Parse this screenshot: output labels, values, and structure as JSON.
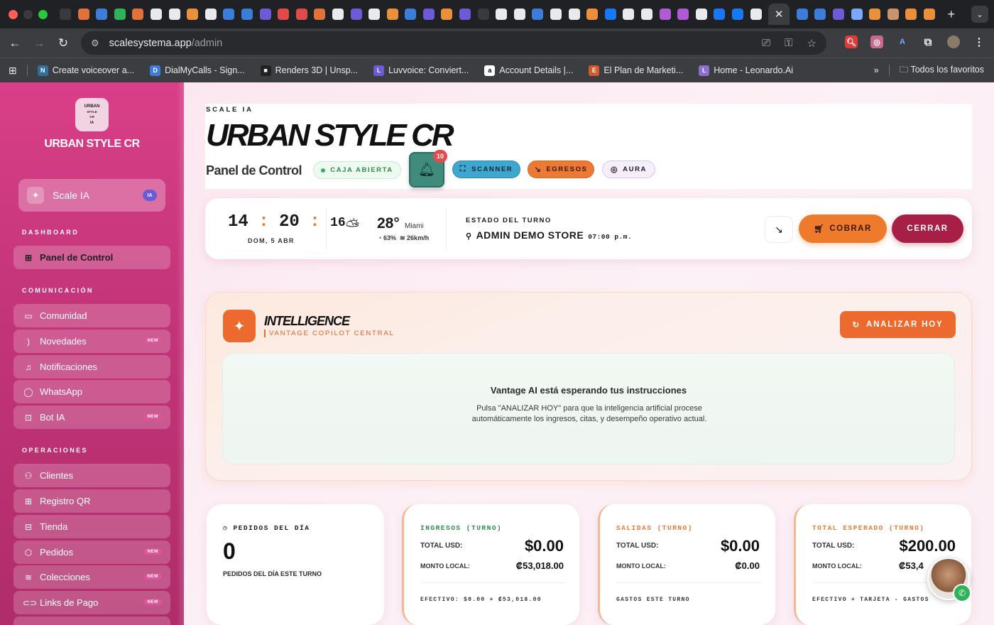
{
  "browser": {
    "url_host": "scalesystema.app",
    "url_path": "/admin",
    "bookmarks": [
      {
        "label": "Create voiceover a...",
        "color": "#2f6f9f",
        "icon_text": "N"
      },
      {
        "label": "DialMyCalls - Sign...",
        "color": "#3b7dd8",
        "icon_text": "D"
      },
      {
        "label": "Renders 3D | Unsp...",
        "color": "#222222",
        "icon_text": "■"
      },
      {
        "label": "Luvvoice: Conviert...",
        "color": "#6b5bd6",
        "icon_text": "L"
      },
      {
        "label": "Account Details |...",
        "color": "#ffffff",
        "icon_text": "a"
      },
      {
        "label": "El Plan de Marketi...",
        "color": "#d35b2b",
        "icon_text": "E"
      },
      {
        "label": "Home - Leonardo.Ai",
        "color": "#8a6fd1",
        "icon_text": "L"
      }
    ],
    "all_bookmarks_label": "Todos los favoritos"
  },
  "sidebar": {
    "logo_text": [
      "URBAN",
      "STYLE",
      "CR",
      "IA"
    ],
    "brand": "URBAN STYLE CR",
    "scale_label": "Scale IA",
    "scale_badge": "IA",
    "sections": {
      "dashboard": "DASHBOARD",
      "comunicacion": "COMUNICACIÓN",
      "operaciones": "OPERACIONES"
    },
    "items": {
      "panel": "Panel de Control",
      "comunidad": "Comunidad",
      "novedades": "Novedades",
      "notificaciones": "Notificaciones",
      "whatsapp": "WhatsApp",
      "botia": "Bot IA",
      "clientes": "Clientes",
      "registroqr": "Registro QR",
      "tienda": "Tienda",
      "pedidos": "Pedidos",
      "colecciones": "Colecciones",
      "links": "Links de Pago"
    },
    "new_badge": "NEW"
  },
  "header": {
    "eyebrow": "SCALE IA",
    "title": "URBAN STYLE CR",
    "subtitle": "Panel de Control",
    "caja_status": "CAJA ABIERTA",
    "notifications_count": "10",
    "scanner": "SCANNER",
    "egresos": "EGRESOS",
    "aura": "AURA"
  },
  "status": {
    "hours": "14",
    "minutes": "20",
    "seconds": "16",
    "date": "DOM, 5 ABR",
    "temperature": "28°",
    "city": "Miami",
    "humidity": "63%",
    "wind": "26km/h",
    "turno_label": "ESTADO DEL TURNO",
    "store": "ADMIN DEMO STORE",
    "turno_time": "07:00 p.m.",
    "cobrar": "COBRAR",
    "cerrar": "CERRAR"
  },
  "intelligence": {
    "title": "INTELLIGENCE",
    "subtitle": "VANTAGE COPILOT CENTRAL",
    "analyze_button": "ANALIZAR HOY",
    "empty_title": "Vantage AI está esperando tus instrucciones",
    "empty_text": "Pulsa \"ANALIZAR HOY\" para que la inteligencia artificial procese automáticamente los ingresos, citas, y desempeño operativo actual."
  },
  "stats": {
    "pedidos": {
      "title": "PEDIDOS DEL DÍA",
      "value": "0",
      "note": "PEDIDOS DEL DÍA ESTE TURNO"
    },
    "ingresos": {
      "title": "INGRESOS (TURNO)",
      "usd_label": "TOTAL USD:",
      "usd": "$0.00",
      "local_label": "MONTO LOCAL:",
      "local": "₡53,018.00",
      "foot": "EFECTIVO: $0.00 + ₡53,018.00"
    },
    "salidas": {
      "title": "SALIDAS (TURNO)",
      "usd_label": "TOTAL USD:",
      "usd": "$0.00",
      "local_label": "MONTO LOCAL:",
      "local": "₡0.00",
      "foot": "GASTOS ESTE TURNO"
    },
    "esperado": {
      "title": "TOTAL ESPERADO (TURNO)",
      "usd_label": "TOTAL USD:",
      "usd": "$200.00",
      "local_label": "MONTO LOCAL:",
      "local": "₡53,4",
      "foot": "EFECTIVO + TARJETA - GASTOS"
    }
  },
  "colors": {
    "sidebar": "#d93f88",
    "accent_orange": "#ec6a2e",
    "cerrar": "#a71f45",
    "scanner": "#3fa6cf",
    "bell": "#3f8c7d"
  }
}
